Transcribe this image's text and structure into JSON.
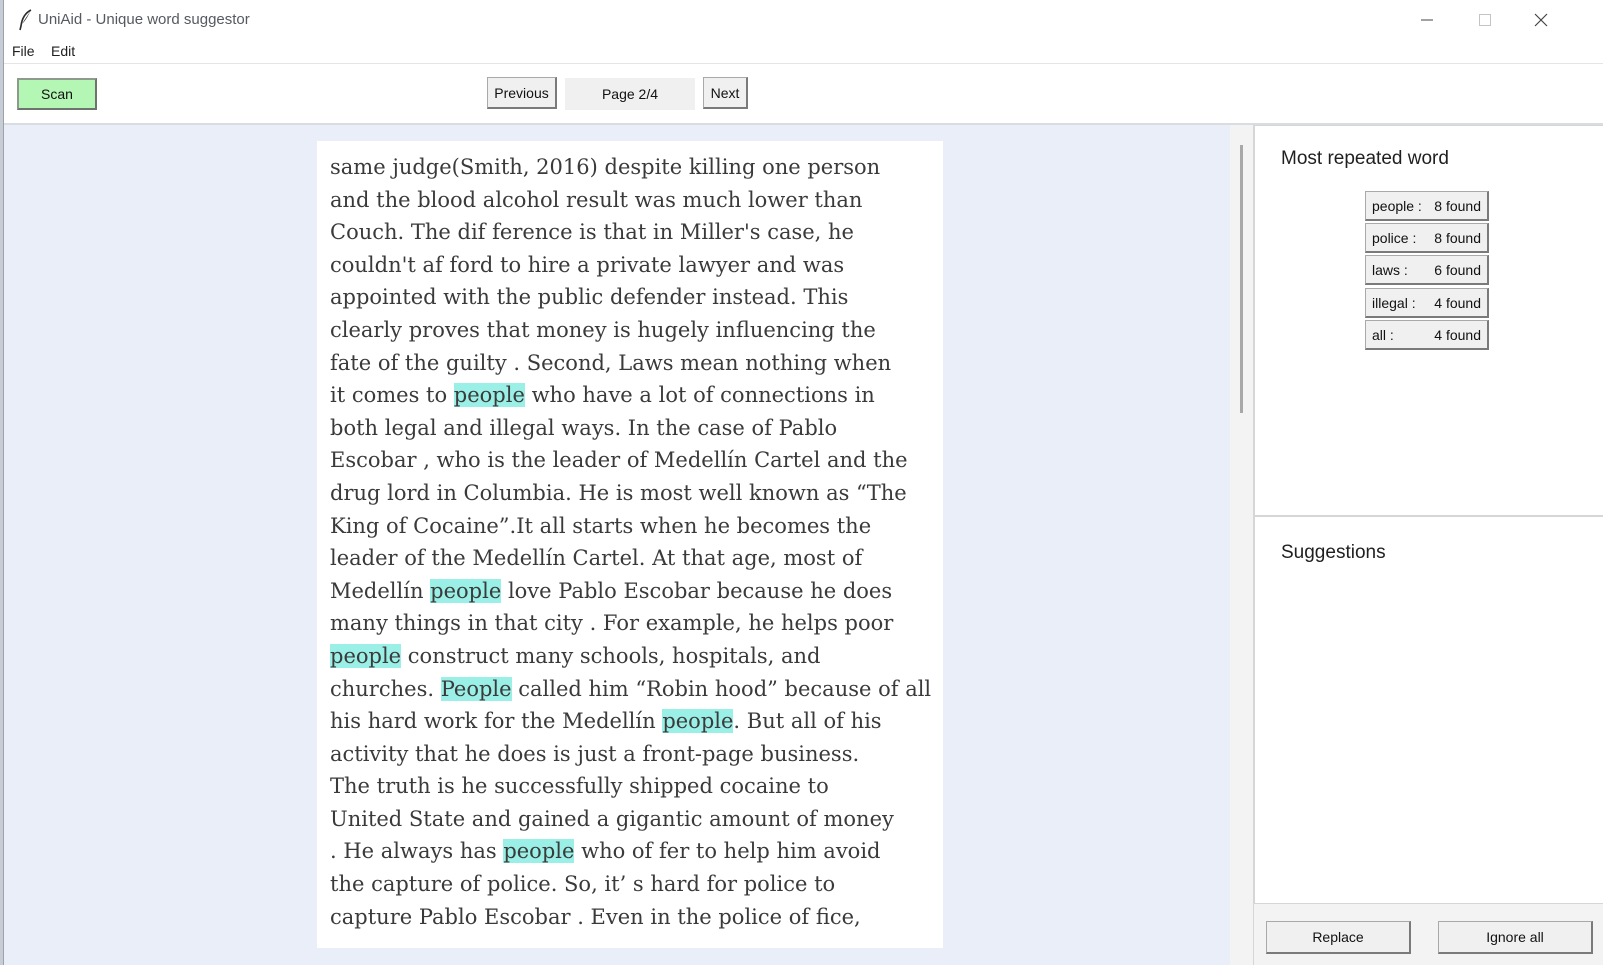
{
  "window": {
    "title": "UniAid - Unique word suggestor"
  },
  "menu": {
    "file": "File",
    "edit": "Edit"
  },
  "toolbar": {
    "scan_label": "Scan",
    "previous_label": "Previous",
    "page_label": "Page 2/4",
    "next_label": "Next",
    "scan_color": "#b4f7b4"
  },
  "document": {
    "highlight_color": "#9af0e6",
    "lines": [
      [
        {
          "t": "same judge(Smith, 2016) despite killing one person"
        }
      ],
      [
        {
          "t": "and the blood alcohol result was much lower than"
        }
      ],
      [
        {
          "t": "Couch. The dif ference is that in Miller's case, he"
        }
      ],
      [
        {
          "t": "couldn't af ford to hire a private lawyer and was"
        }
      ],
      [
        {
          "t": "appointed with the public defender instead. This"
        }
      ],
      [
        {
          "t": "clearly proves that money is hugely influencing the"
        }
      ],
      [
        {
          "t": "fate of the guilty . Second, Laws mean nothing when"
        }
      ],
      [
        {
          "t": "it comes to "
        },
        {
          "t": "people",
          "h": true
        },
        {
          "t": " who have a lot of connections in"
        }
      ],
      [
        {
          "t": "both legal and illegal ways. In the case of Pablo"
        }
      ],
      [
        {
          "t": "Escobar , who is the leader of Medellín Cartel and the"
        }
      ],
      [
        {
          "t": "drug lord in Columbia. He is most well known as “The"
        }
      ],
      [
        {
          "t": "King of Cocaine”.It all starts when he becomes the"
        }
      ],
      [
        {
          "t": "leader of the Medellín Cartel. At that age, most of"
        }
      ],
      [
        {
          "t": "Medellín "
        },
        {
          "t": "people",
          "h": true
        },
        {
          "t": " love Pablo Escobar because he does"
        }
      ],
      [
        {
          "t": "many things in that city . For example, he helps poor"
        }
      ],
      [
        {
          "t": "people",
          "h": true
        },
        {
          "t": " construct many schools, hospitals, and"
        }
      ],
      [
        {
          "t": "churches. "
        },
        {
          "t": "People",
          "h": true
        },
        {
          "t": " called him “Robin hood” because of all"
        }
      ],
      [
        {
          "t": "his hard work for the Medellín "
        },
        {
          "t": "people",
          "h": true
        },
        {
          "t": ". But all of his"
        }
      ],
      [
        {
          "t": "activity that he does is just a front-page business."
        }
      ],
      [
        {
          "t": "The truth is he successfully shipped cocaine to"
        }
      ],
      [
        {
          "t": "United State and gained a gigantic amount of money"
        }
      ],
      [
        {
          "t": ". He always has "
        },
        {
          "t": "people",
          "h": true
        },
        {
          "t": " who of fer to help him avoid"
        }
      ],
      [
        {
          "t": "the capture of police. So, it’ s hard for police to"
        }
      ],
      [
        {
          "t": "capture Pablo Escobar . Even in the police of fice,"
        }
      ]
    ]
  },
  "sidebar": {
    "most_repeated_title": "Most repeated word",
    "words": [
      {
        "word": "people :",
        "count": "8 found"
      },
      {
        "word": "police  :",
        "count": "8 found"
      },
      {
        "word": "laws  :",
        "count": "6 found"
      },
      {
        "word": "illegal  :",
        "count": "4 found"
      },
      {
        "word": "all  :",
        "count": "4 found"
      }
    ],
    "suggestions_title": "Suggestions",
    "replace_label": "Replace",
    "ignore_all_label": "Ignore all"
  },
  "icons": {
    "app": "feather-icon",
    "minimize": "minimize-icon",
    "maximize": "maximize-icon",
    "close": "close-icon"
  }
}
